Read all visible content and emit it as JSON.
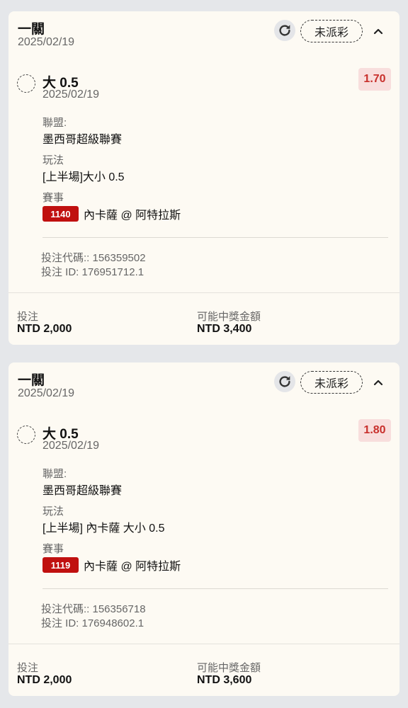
{
  "bets": [
    {
      "header": {
        "title": "一關",
        "date": "2025/02/19",
        "status": "未派彩"
      },
      "selection": {
        "name": "大 0.5",
        "date": "2025/02/19",
        "odds": "1.70",
        "league_label": "聯盟:",
        "league": "墨西哥超級聯賽",
        "bet_type_label": "玩法",
        "bet_type": "[上半場]大小 0.5",
        "event_label": "賽事",
        "match_id": "1140",
        "match": "內卡薩 @ 阿特拉斯"
      },
      "codes": {
        "bet_code": "投注代碼:: 156359502",
        "bet_id": "投注 ID: 176951712.1"
      },
      "footer": {
        "stake_label": "投注",
        "stake": "NTD 2,000",
        "payout_label": "可能中獎金額",
        "payout": "NTD 3,400"
      }
    },
    {
      "header": {
        "title": "一關",
        "date": "2025/02/19",
        "status": "未派彩"
      },
      "selection": {
        "name": "大 0.5",
        "date": "2025/02/19",
        "odds": "1.80",
        "league_label": "聯盟:",
        "league": "墨西哥超級聯賽",
        "bet_type_label": "玩法",
        "bet_type": "[上半場] 內卡薩 大小 0.5",
        "event_label": "賽事",
        "match_id": "1119",
        "match": "內卡薩 @ 阿特拉斯"
      },
      "codes": {
        "bet_code": "投注代碼:: 156356718",
        "bet_id": "投注 ID: 176948602.1"
      },
      "footer": {
        "stake_label": "投注",
        "stake": "NTD 2,000",
        "payout_label": "可能中獎金額",
        "payout": "NTD 3,600"
      }
    }
  ],
  "icons": {
    "refresh": "refresh-icon",
    "collapse": "chevron-up-icon",
    "selection": "dashed-radio-icon"
  },
  "colors": {
    "odds_text": "#c8302c",
    "odds_bg": "#f8dedd",
    "match_badge": "#c0100f",
    "card_bg": "#fdfaf3",
    "page_bg": "#e5e7ea"
  }
}
